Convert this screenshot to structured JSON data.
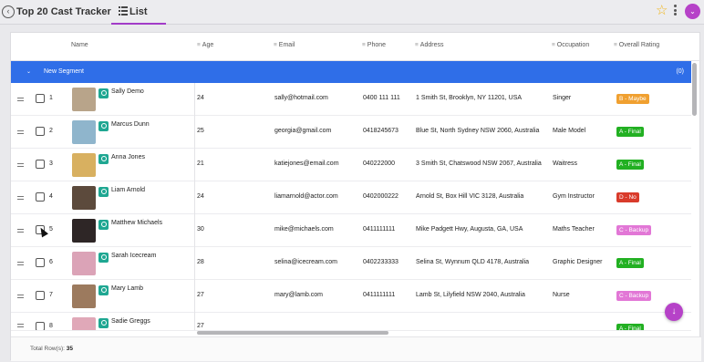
{
  "topbar": {
    "back_glyph": "‹",
    "title": "Top 20 Cast Tracker",
    "tab_label": "List",
    "star_glyph": "☆",
    "profile_glyph": "⌄"
  },
  "header": {
    "name": "Name",
    "age": "Age",
    "email": "Email",
    "phone": "Phone",
    "address": "Address",
    "occupation": "Occupation",
    "rating": "Overall Rating",
    "type_glyph": "≡"
  },
  "segment": {
    "chev": "⌄",
    "name": "New Segment",
    "count": "(0)"
  },
  "rows": [
    {
      "num": "1",
      "name": "Sally Demo",
      "age": "24",
      "email": "sally@hotmail.com",
      "phone": "0400 111 111",
      "address": "1 Smith St, Brooklyn, NY 11201, USA",
      "occupation": "Singer",
      "rating": "B - Maybe",
      "rating_color": "#f0a030",
      "photo": "#b8a48a"
    },
    {
      "num": "2",
      "name": "Marcus Dunn",
      "age": "25",
      "email": "georgia@gmail.com",
      "phone": "0418245673",
      "address": "Blue St, North Sydney NSW 2060, Australia",
      "occupation": "Male Model",
      "rating": "A - Final",
      "rating_color": "#22b022",
      "photo": "#8fb5cc"
    },
    {
      "num": "3",
      "name": "Anna Jones",
      "age": "21",
      "email": "katiejones@email.com",
      "phone": "040222000",
      "address": "3 Smith St, Chatswood NSW 2067, Australia",
      "occupation": "Waitress",
      "rating": "A - Final",
      "rating_color": "#22b022",
      "photo": "#d8b060"
    },
    {
      "num": "4",
      "name": "Liam Arnold",
      "age": "24",
      "email": "liamarnold@actor.com",
      "phone": "0402000222",
      "address": "Arnold St, Box Hill VIC 3128, Australia",
      "occupation": "Gym Instructor",
      "rating": "D - No",
      "rating_color": "#d93b2b",
      "photo": "#5c4a3c"
    },
    {
      "num": "5",
      "name": "Matthew Michaels",
      "age": "30",
      "email": "mike@michaels.com",
      "phone": "0411111111",
      "address": "Mike Padgett Hwy, Augusta, GA, USA",
      "occupation": "Maths Teacher",
      "rating": "C - Backup",
      "rating_color": "#e277d6",
      "photo": "#2e2626"
    },
    {
      "num": "6",
      "name": "Sarah Icecream",
      "age": "28",
      "email": "selina@icecream.com",
      "phone": "0402233333",
      "address": "Selina St, Wynnum QLD 4178, Australia",
      "occupation": "Graphic Designer",
      "rating": "A - Final",
      "rating_color": "#22b022",
      "photo": "#dba3b7"
    },
    {
      "num": "7",
      "name": "Mary Lamb",
      "age": "27",
      "email": "mary@lamb.com",
      "phone": "0411111111",
      "address": "Lamb St, Lilyfield NSW 2040, Australia",
      "occupation": "Nurse",
      "rating": "C - Backup",
      "rating_color": "#e277d6",
      "photo": "#9c7a5e"
    },
    {
      "num": "8",
      "name": "Sadie Greggs",
      "age": "27",
      "email": "",
      "phone": "",
      "address": "",
      "occupation": "",
      "rating": "A - Final",
      "rating_color": "#22b022",
      "photo": "#e0a8b8"
    }
  ],
  "footer": {
    "label": "Total Row(s):",
    "count": "35"
  },
  "fab_glyph": "↓"
}
